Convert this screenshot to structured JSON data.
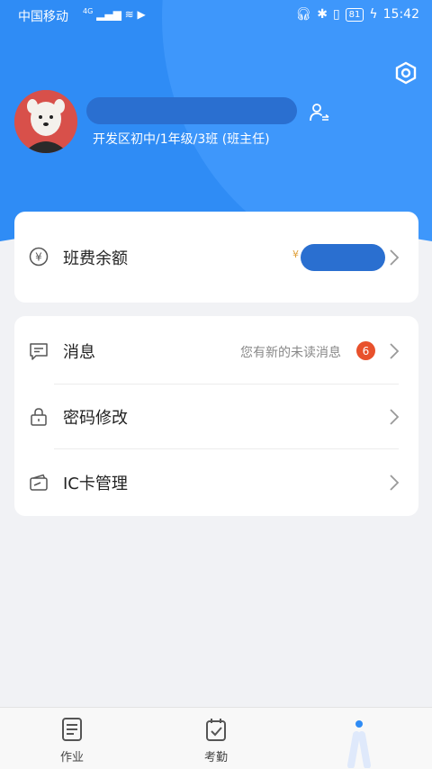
{
  "status_bar": {
    "carrier": "中国移动",
    "network": "4G",
    "battery": "81",
    "time": "15:42"
  },
  "profile": {
    "subtitle": "开发区初中/1年级/3班 (班主任)"
  },
  "balance_card": {
    "label": "班费余额",
    "currency_symbol": "¥"
  },
  "menu": {
    "items": [
      {
        "label": "消息",
        "hint": "您有新的未读消息",
        "badge": "6"
      },
      {
        "label": "密码修改"
      },
      {
        "label": "IC卡管理"
      }
    ]
  },
  "tabbar": {
    "tabs": [
      {
        "label": "作业"
      },
      {
        "label": "考勤"
      }
    ]
  },
  "colors": {
    "primary": "#2f8cf5",
    "badge": "#e8512c",
    "redaction": "#2a6fd0"
  }
}
